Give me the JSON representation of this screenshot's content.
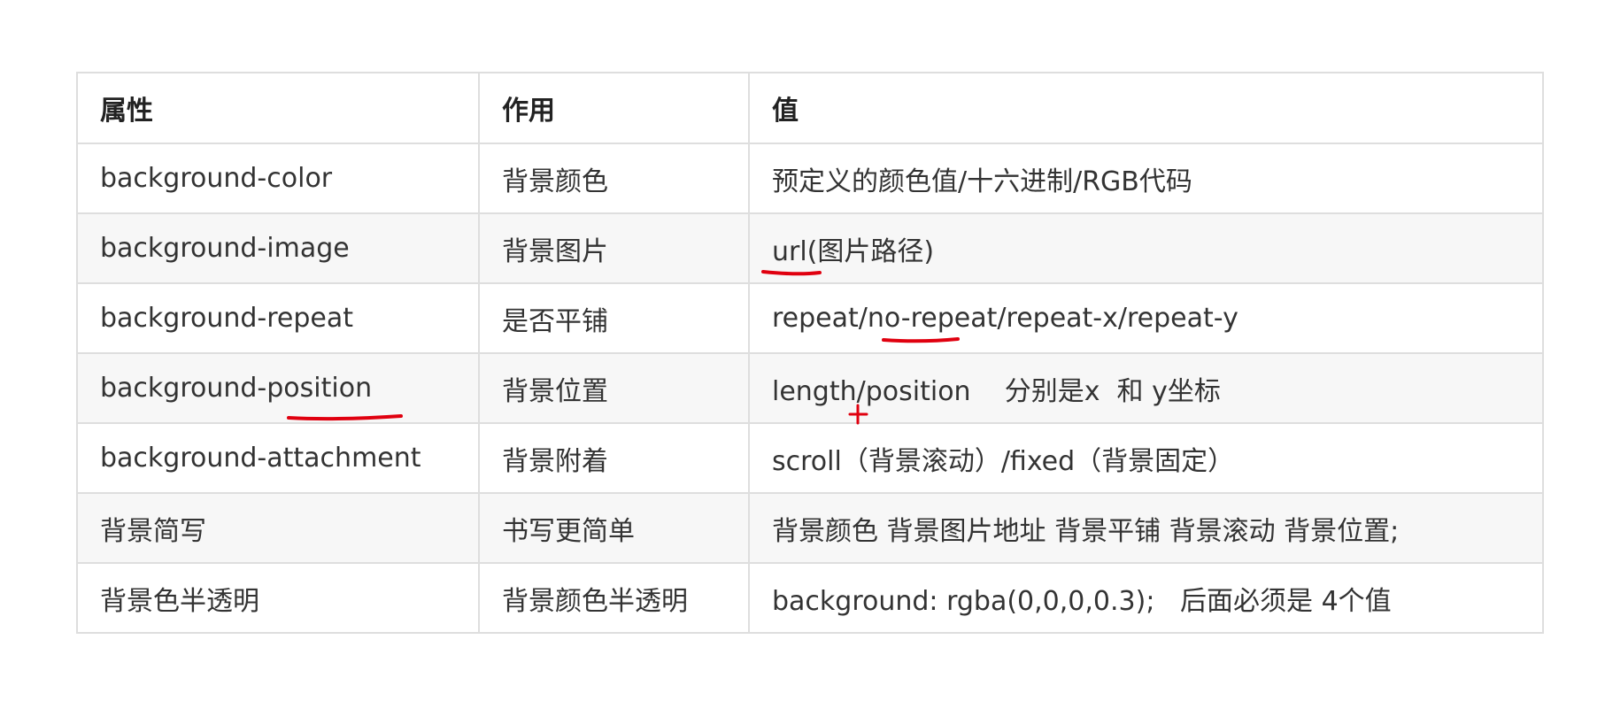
{
  "table": {
    "headers": [
      "属性",
      "作用",
      "值"
    ],
    "rows": [
      [
        "background-color",
        "背景颜色",
        "预定义的颜色值/十六进制/RGB代码"
      ],
      [
        "background-image",
        "背景图片",
        "url(图片路径)"
      ],
      [
        "background-repeat",
        "是否平铺",
        "repeat/no-repeat/repeat-x/repeat-y"
      ],
      [
        "background-position",
        "背景位置",
        "length/position    分别是x  和 y坐标"
      ],
      [
        "background-attachment",
        "背景附着",
        "scroll（背景滚动）/fixed（背景固定）"
      ],
      [
        "背景简写",
        "书写更简单",
        "背景颜色 背景图片地址 背景平铺 背景滚动 背景位置;"
      ],
      [
        "背景色半透明",
        "背景颜色半透明",
        "background: rgba(0,0,0,0.3);   后面必须是 4个值"
      ]
    ]
  },
  "annotations": {
    "ink_color": "#e0000f"
  }
}
